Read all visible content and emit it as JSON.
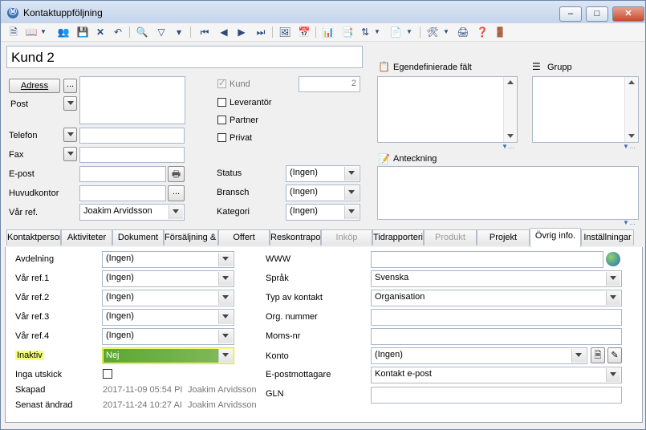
{
  "window": {
    "title": "Kontaktuppföljning"
  },
  "customer_name": "Kund 2",
  "left": {
    "adress_button": "Adress",
    "browse": "...",
    "post_label": "Post",
    "telefon_label": "Telefon",
    "fax_label": "Fax",
    "epost_label": "E-post",
    "huvudkontor_label": "Huvudkontor",
    "var_ref_label": "Vår ref.",
    "var_ref_value": "Joakim Arvidsson"
  },
  "middle": {
    "kund_label": "Kund",
    "kund_number": "2",
    "leverantor_label": "Leverantör",
    "partner_label": "Partner",
    "privat_label": "Privat",
    "status_label": "Status",
    "status_value": "(Ingen)",
    "bransch_label": "Bransch",
    "bransch_value": "(Ingen)",
    "kategori_label": "Kategori",
    "kategori_value": "(Ingen)"
  },
  "right": {
    "egen_label": "Egendefinierade fält",
    "grupp_label": "Grupp",
    "anteckning_label": "Anteckning"
  },
  "tabs": [
    {
      "label": "Kontaktpersoner"
    },
    {
      "label": "Aktiviteter"
    },
    {
      "label": "Dokument"
    },
    {
      "label": "Försäljning & Marknad"
    },
    {
      "label": "Offert"
    },
    {
      "label": "Reskontraposter"
    },
    {
      "label": "Inköp"
    },
    {
      "label": "Tidrapportering"
    },
    {
      "label": "Produkt"
    },
    {
      "label": "Projekt"
    },
    {
      "label": "Övrig info."
    },
    {
      "label": "Inställningar"
    }
  ],
  "ovrig": {
    "avdelning_label": "Avdelning",
    "avdelning_value": "(Ingen)",
    "var_ref1_label": "Vår ref.1",
    "var_ref1_value": "(Ingen)",
    "var_ref2_label": "Vår ref.2",
    "var_ref2_value": "(Ingen)",
    "var_ref3_label": "Vår ref.3",
    "var_ref3_value": "(Ingen)",
    "var_ref4_label": "Vår ref.4",
    "var_ref4_value": "(Ingen)",
    "inaktiv_label": "Inaktiv",
    "inaktiv_value": "Nej",
    "inga_utskick_label": "Inga utskick",
    "skapad_label": "Skapad",
    "skapad_date": "2017-11-09 05:54 PI",
    "skapad_user": "Joakim Arvidsson",
    "senast_label": "Senast ändrad",
    "senast_date": "2017-11-24 10:27 AI",
    "senast_user": "Joakim Arvidsson",
    "www_label": "WWW",
    "sprak_label": "Språk",
    "sprak_value": "Svenska",
    "typ_label": "Typ av kontakt",
    "typ_value": "Organisation",
    "org_label": "Org. nummer",
    "moms_label": "Moms-nr",
    "konto_label": "Konto",
    "konto_value": "(Ingen)",
    "epostmottagare_label": "E-postmottagare",
    "epostmottagare_value": "Kontakt e-post",
    "gln_label": "GLN"
  },
  "colors": {
    "highlight": "#f6ff7a",
    "selection": "#5aa832"
  }
}
